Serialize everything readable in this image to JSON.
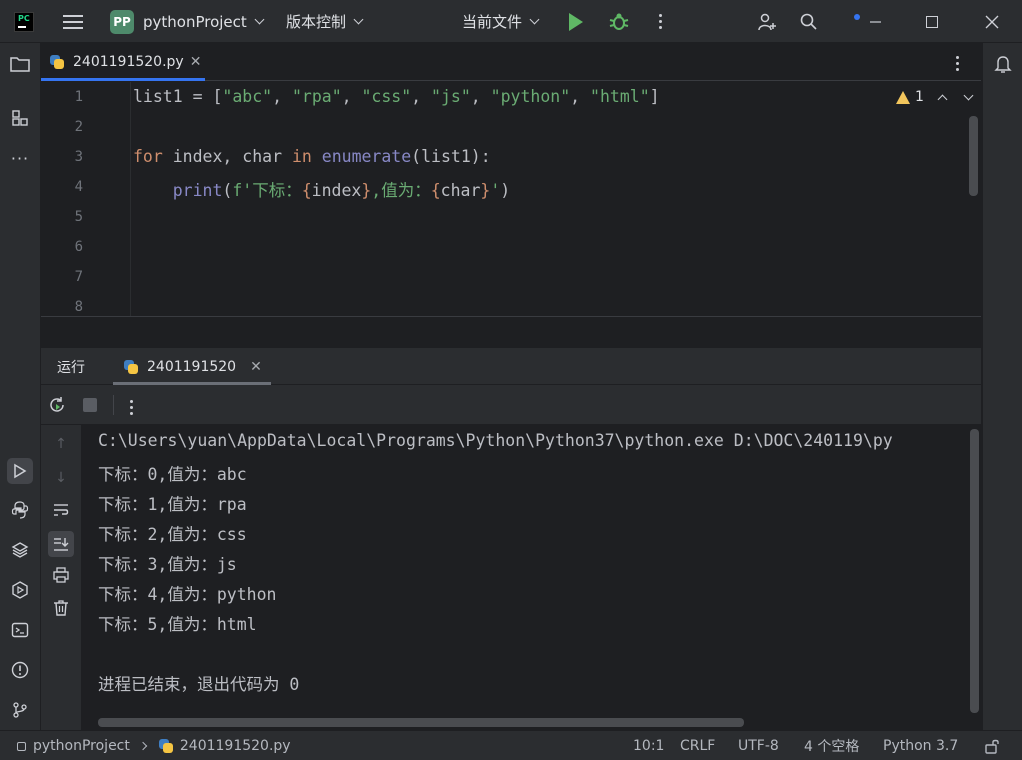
{
  "titlebar": {
    "project_initials": "PP",
    "project_name": "pythonProject",
    "vcs_label": "版本控制",
    "run_config": "当前文件"
  },
  "editor": {
    "tab_file": "2401191520.py",
    "warnings_count": "1",
    "line_numbers": [
      "1",
      "2",
      "3",
      "4",
      "5",
      "6",
      "7",
      "8"
    ],
    "code": {
      "line1": {
        "a": "list1 = [",
        "s1": "\"abc\"",
        "c1": ", ",
        "s2": "\"rpa\"",
        "c2": ", ",
        "s3": "\"css\"",
        "c3": ", ",
        "s4": "\"js\"",
        "c4": ", ",
        "s5": "\"python\"",
        "c5": ", ",
        "s6": "\"html\"",
        "z": "]"
      },
      "line3": {
        "kw_for": "for",
        "vars": " index, char ",
        "kw_in": "in",
        "sp": " ",
        "fn": "enumerate",
        "args": "(list1):"
      },
      "line4": {
        "indent": "    ",
        "fn": "print",
        "open": "(",
        "fpref": "f'下标：",
        "b1o": "{",
        "v1": "index",
        "b1c": "}",
        "mid": ",值为：",
        "b2o": "{",
        "v2": "char",
        "b2c": "}",
        "fend": "'",
        "close": ")"
      }
    }
  },
  "run": {
    "title": "运行",
    "tab_name": "2401191520",
    "console_lines": [
      "C:\\Users\\yuan\\AppData\\Local\\Programs\\Python\\Python37\\python.exe D:\\DOC\\240119\\py",
      "下标：0,值为：abc",
      "下标：1,值为：rpa",
      "下标：2,值为：css",
      "下标：3,值为：js",
      "下标：4,值为：python",
      "下标：5,值为：html",
      "",
      "进程已结束，退出代码为 0"
    ]
  },
  "statusbar": {
    "breadcrumb_project": "pythonProject",
    "breadcrumb_file": "2401191520.py",
    "position": "10:1",
    "line_separator": "CRLF",
    "encoding": "UTF-8",
    "indent": "4 个空格",
    "interpreter": "Python 3.7"
  },
  "colors": {
    "accent": "#3574f0",
    "run_green": "#5fb865",
    "background": "#1e1f22",
    "panel": "#2b2d30"
  }
}
